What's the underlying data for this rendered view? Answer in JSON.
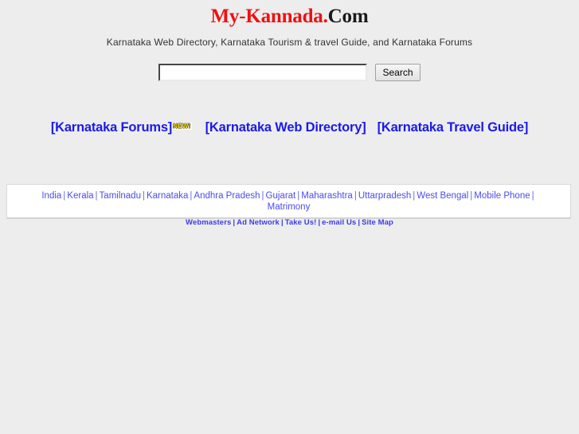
{
  "header": {
    "logo_brand": "My-Kannada.",
    "logo_tld": "Com",
    "logo_brand_color": "#ee1111",
    "logo_tld_color": "#1a1a1a",
    "tagline": "Karnataka Web Directory, Karnataka Tourism & travel Guide, and Karnataka Forums"
  },
  "search": {
    "value": "",
    "placeholder": "",
    "button_label": "Search"
  },
  "main_nav": {
    "link_color": "#1a1aea",
    "items": [
      {
        "label": "[Karnataka Forums]",
        "badge": "NEW!"
      },
      {
        "label": "[Karnataka Web Directory]",
        "badge": ""
      },
      {
        "label": "[Karnataka Travel Guide]",
        "badge": ""
      }
    ]
  },
  "states_panel": {
    "link_color": "#4b4bee",
    "separator": "|",
    "line1": [
      "India",
      "Kerala",
      "Tamilnadu",
      "Karnataka",
      "Andhra Pradesh",
      "Gujarat",
      "Maharashtra",
      "Uttarpradesh",
      "West Bengal",
      "Mobile Phone"
    ],
    "line2": [
      "Matrimony"
    ]
  },
  "footer": {
    "link_color": "#3c3ce4",
    "separator": "|",
    "items": [
      "Webmasters",
      "Ad Network",
      "Take Us!",
      "e-mail Us",
      "Site Map"
    ]
  }
}
